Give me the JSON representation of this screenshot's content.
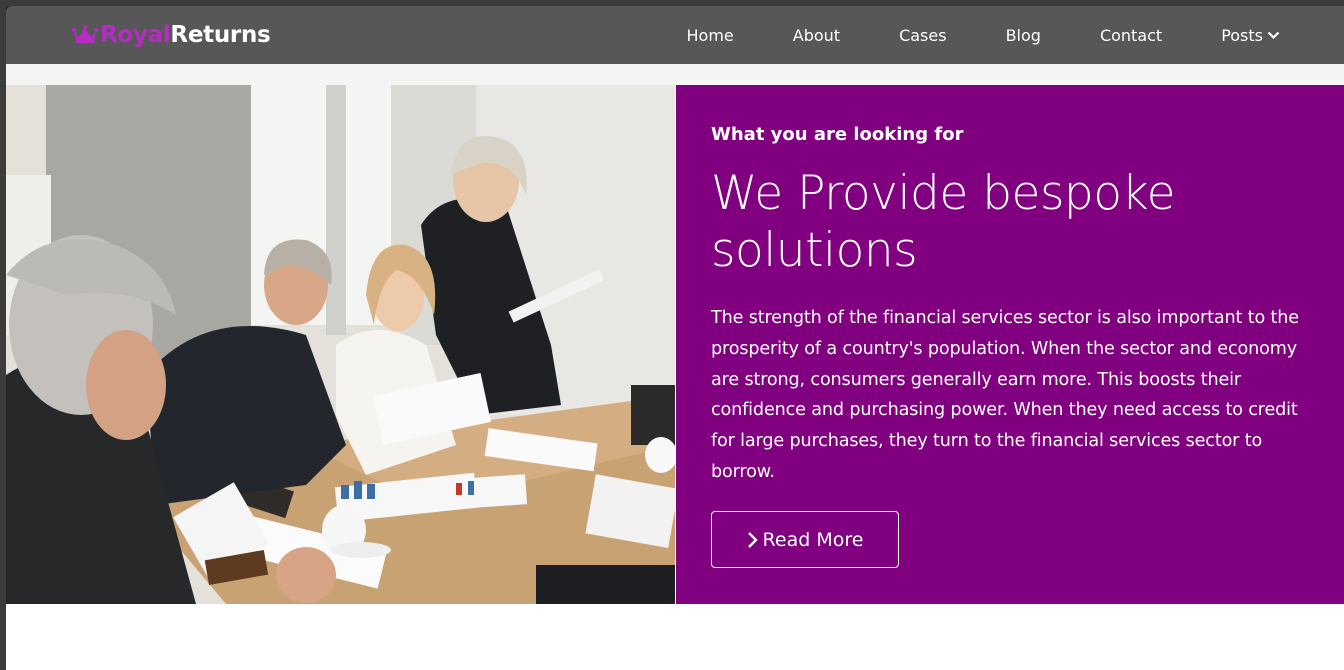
{
  "brand": {
    "part1": "Royal",
    "part2": "Returns",
    "accent_color": "#b42cc4"
  },
  "nav": {
    "items": [
      {
        "label": "Home"
      },
      {
        "label": "About"
      },
      {
        "label": "Cases"
      },
      {
        "label": "Blog"
      },
      {
        "label": "Contact"
      },
      {
        "label": "Posts",
        "has_dropdown": true
      }
    ]
  },
  "hero": {
    "eyebrow": "What you are looking for",
    "headline": "We Provide bespoke solutions",
    "body": "The strength of the financial services sector is also important to the prosperity of a country's population. When the sector and economy are strong, consumers generally earn more. This boosts their confidence and purchasing power. When they need access to credit for large purchases, they turn to the financial services sector to borrow.",
    "button_label": "Read More",
    "panel_color": "#800080",
    "photo_icon": "business-meeting-photo"
  },
  "colors": {
    "navbar": "#575757",
    "page_bg": "#ffffff"
  }
}
